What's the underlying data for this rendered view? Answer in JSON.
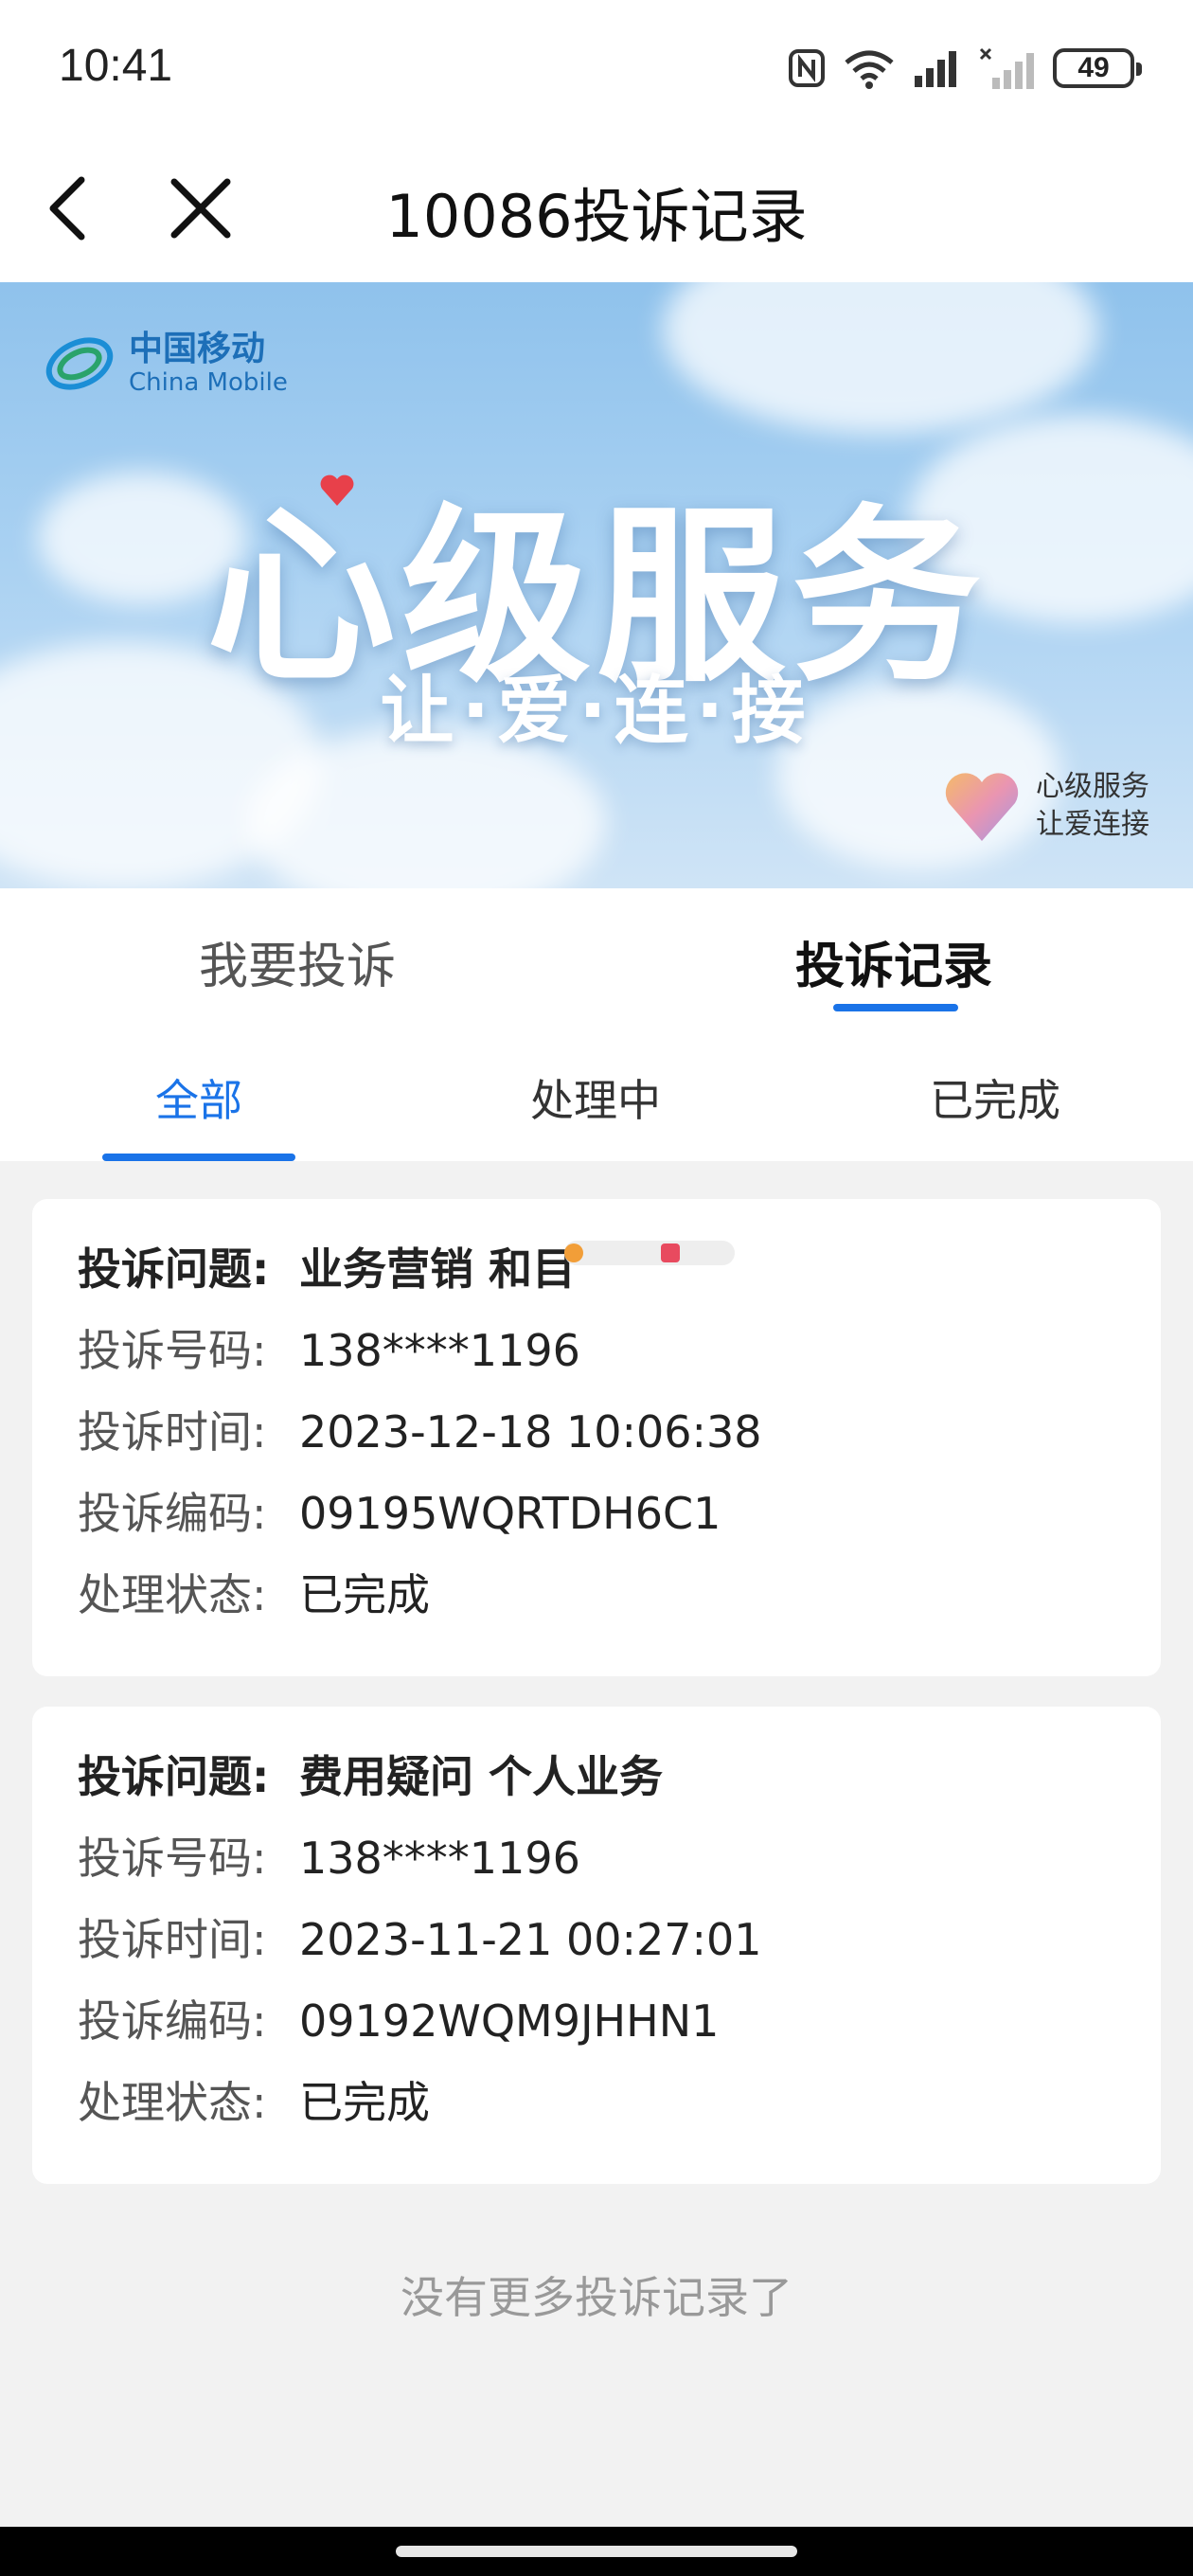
{
  "status_bar": {
    "time": "10:41",
    "battery": "49",
    "icons": [
      "nfc-icon",
      "wifi-icon",
      "signal-icon",
      "signal-no-sim-icon",
      "battery-icon"
    ]
  },
  "nav": {
    "title": "10086投诉记录",
    "back_icon": "chevron-left-icon",
    "close_icon": "close-icon"
  },
  "banner": {
    "logo_cn": "中国移动",
    "logo_en": "China Mobile",
    "title": "心级服务",
    "subtitle": "让·爱·连·接",
    "badge_line1": "心级服务",
    "badge_line2": "让爱连接"
  },
  "main_tabs": [
    {
      "label": "我要投诉",
      "active": false
    },
    {
      "label": "投诉记录",
      "active": true
    }
  ],
  "sub_tabs": [
    {
      "label": "全部",
      "active": true
    },
    {
      "label": "处理中",
      "active": false
    },
    {
      "label": "已完成",
      "active": false
    }
  ],
  "records": [
    {
      "issue_label": "投诉问题:",
      "issue": "业务营销 和目",
      "number_label": "投诉号码:",
      "number": "138****1196",
      "time_label": "投诉时间:",
      "time": "2023-12-18 10:06:38",
      "code_label": "投诉编码:",
      "code": "09195WQRTDH6C1",
      "status_label": "处理状态:",
      "status": "已完成"
    },
    {
      "issue_label": "投诉问题:",
      "issue": "费用疑问 个人业务",
      "number_label": "投诉号码:",
      "number": "138****1196",
      "time_label": "投诉时间:",
      "time": "2023-11-21 00:27:01",
      "code_label": "投诉编码:",
      "code": "09192WQM9JHHN1",
      "status_label": "处理状态:",
      "status": "已完成"
    }
  ],
  "footer_text": "没有更多投诉记录了",
  "colors": {
    "accent": "#1a73e8",
    "banner_sky": "#a9d1f2",
    "page_bg": "#f2f2f2"
  }
}
